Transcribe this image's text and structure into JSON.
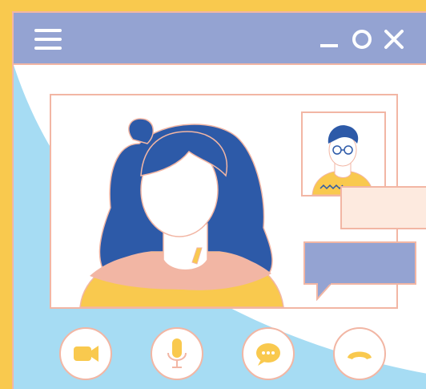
{
  "window": {
    "titlebar_color": "#94A3D2",
    "border_color": "#F2B6A4",
    "frame_color": "#F9C94E",
    "background_shape_color": "#A6DCF3"
  },
  "titlebar": {
    "icons": [
      "hamburger-menu-icon",
      "minimize-icon",
      "maximize-icon",
      "close-icon"
    ]
  },
  "video_call": {
    "main_participant": "woman-with-blue-hair",
    "secondary_participant": "man-with-glasses"
  },
  "chat_bubbles": {
    "peach_color": "#FDEADF",
    "blue_color": "#94A3D2"
  },
  "controls": {
    "buttons": [
      "video-camera-icon",
      "microphone-icon",
      "chat-icon",
      "hang-up-icon"
    ],
    "icon_color": "#F9C94E"
  }
}
